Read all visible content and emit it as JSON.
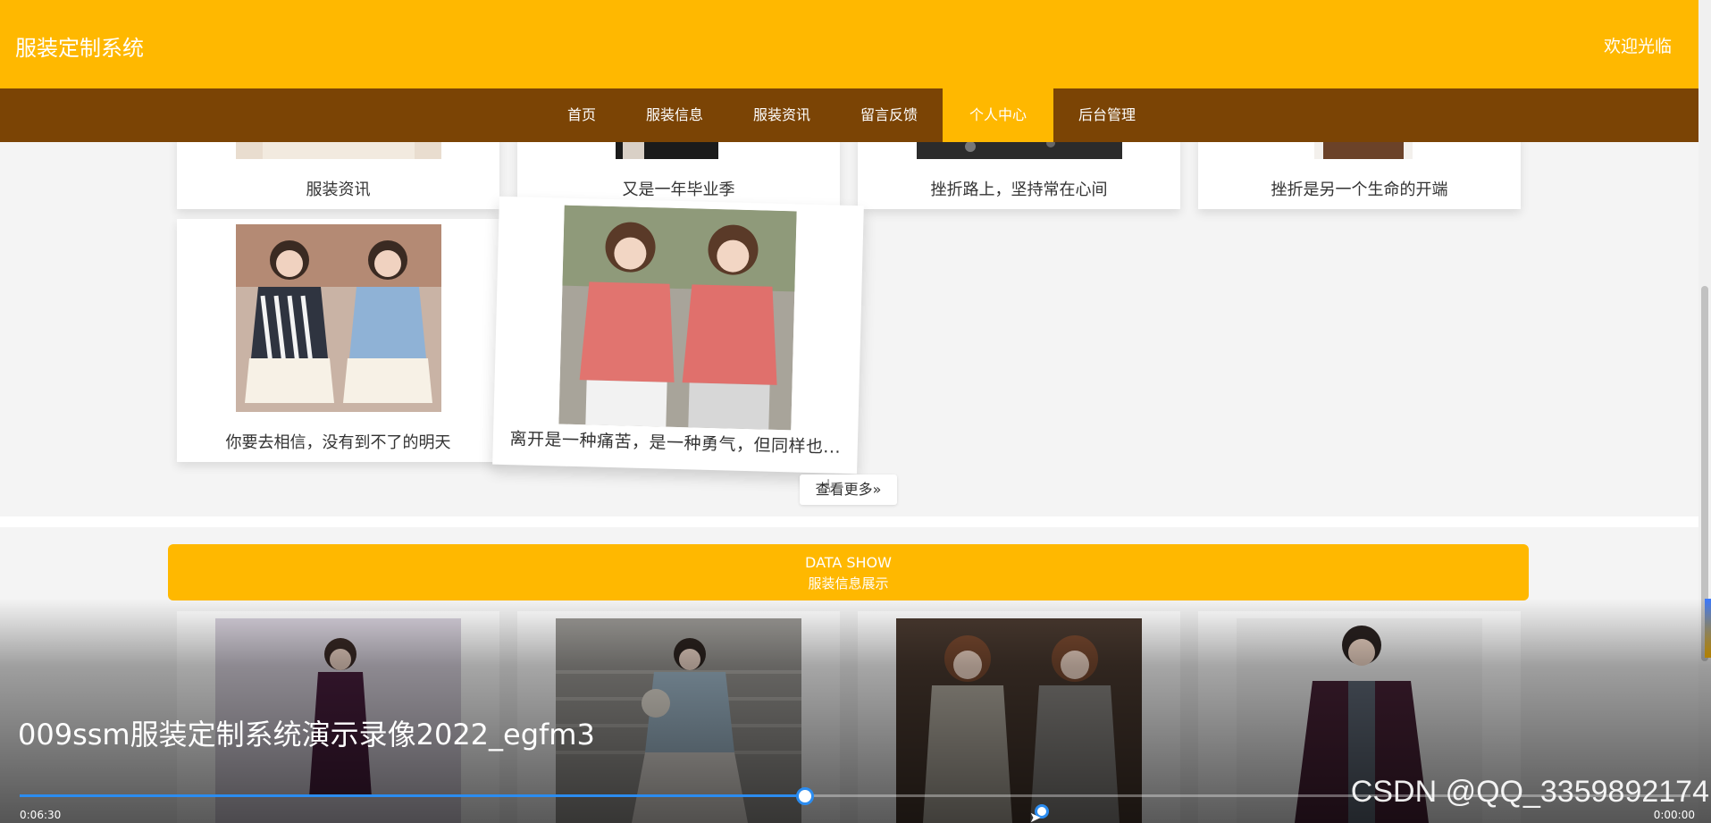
{
  "header": {
    "site_title": "服装定制系统",
    "welcome": "欢迎光临"
  },
  "nav": {
    "items": [
      {
        "label": "首页"
      },
      {
        "label": "服装信息"
      },
      {
        "label": "服装资讯"
      },
      {
        "label": "留言反馈"
      },
      {
        "label": "个人中心",
        "active": true
      },
      {
        "label": "后台管理"
      }
    ]
  },
  "news": {
    "row1": [
      {
        "caption": "服装资讯"
      },
      {
        "caption": "又是一年毕业季"
      },
      {
        "caption": "挫折路上，坚持常在心间"
      },
      {
        "caption": "挫折是另一个生命的开端"
      }
    ],
    "row2": [
      {
        "caption": "你要去相信，没有到不了的明天"
      },
      {
        "caption": "离开是一种痛苦，是一种勇气，但同样也..."
      }
    ],
    "more_label": "查看更多"
  },
  "data_show": {
    "title_en": "DATA SHOW",
    "title_zh": "服装信息展示"
  },
  "video": {
    "title": "009ssm服装定制系统演示录像2022_egfm3",
    "time_elapsed": "0:06:30",
    "time_total": "0:00:00",
    "progress": 0.47,
    "watermark": "CSDN @QQ_3359892174"
  },
  "colors": {
    "accent": "#ffb800",
    "nav_bg": "#7b4405",
    "progress": "#2b8cf0"
  }
}
